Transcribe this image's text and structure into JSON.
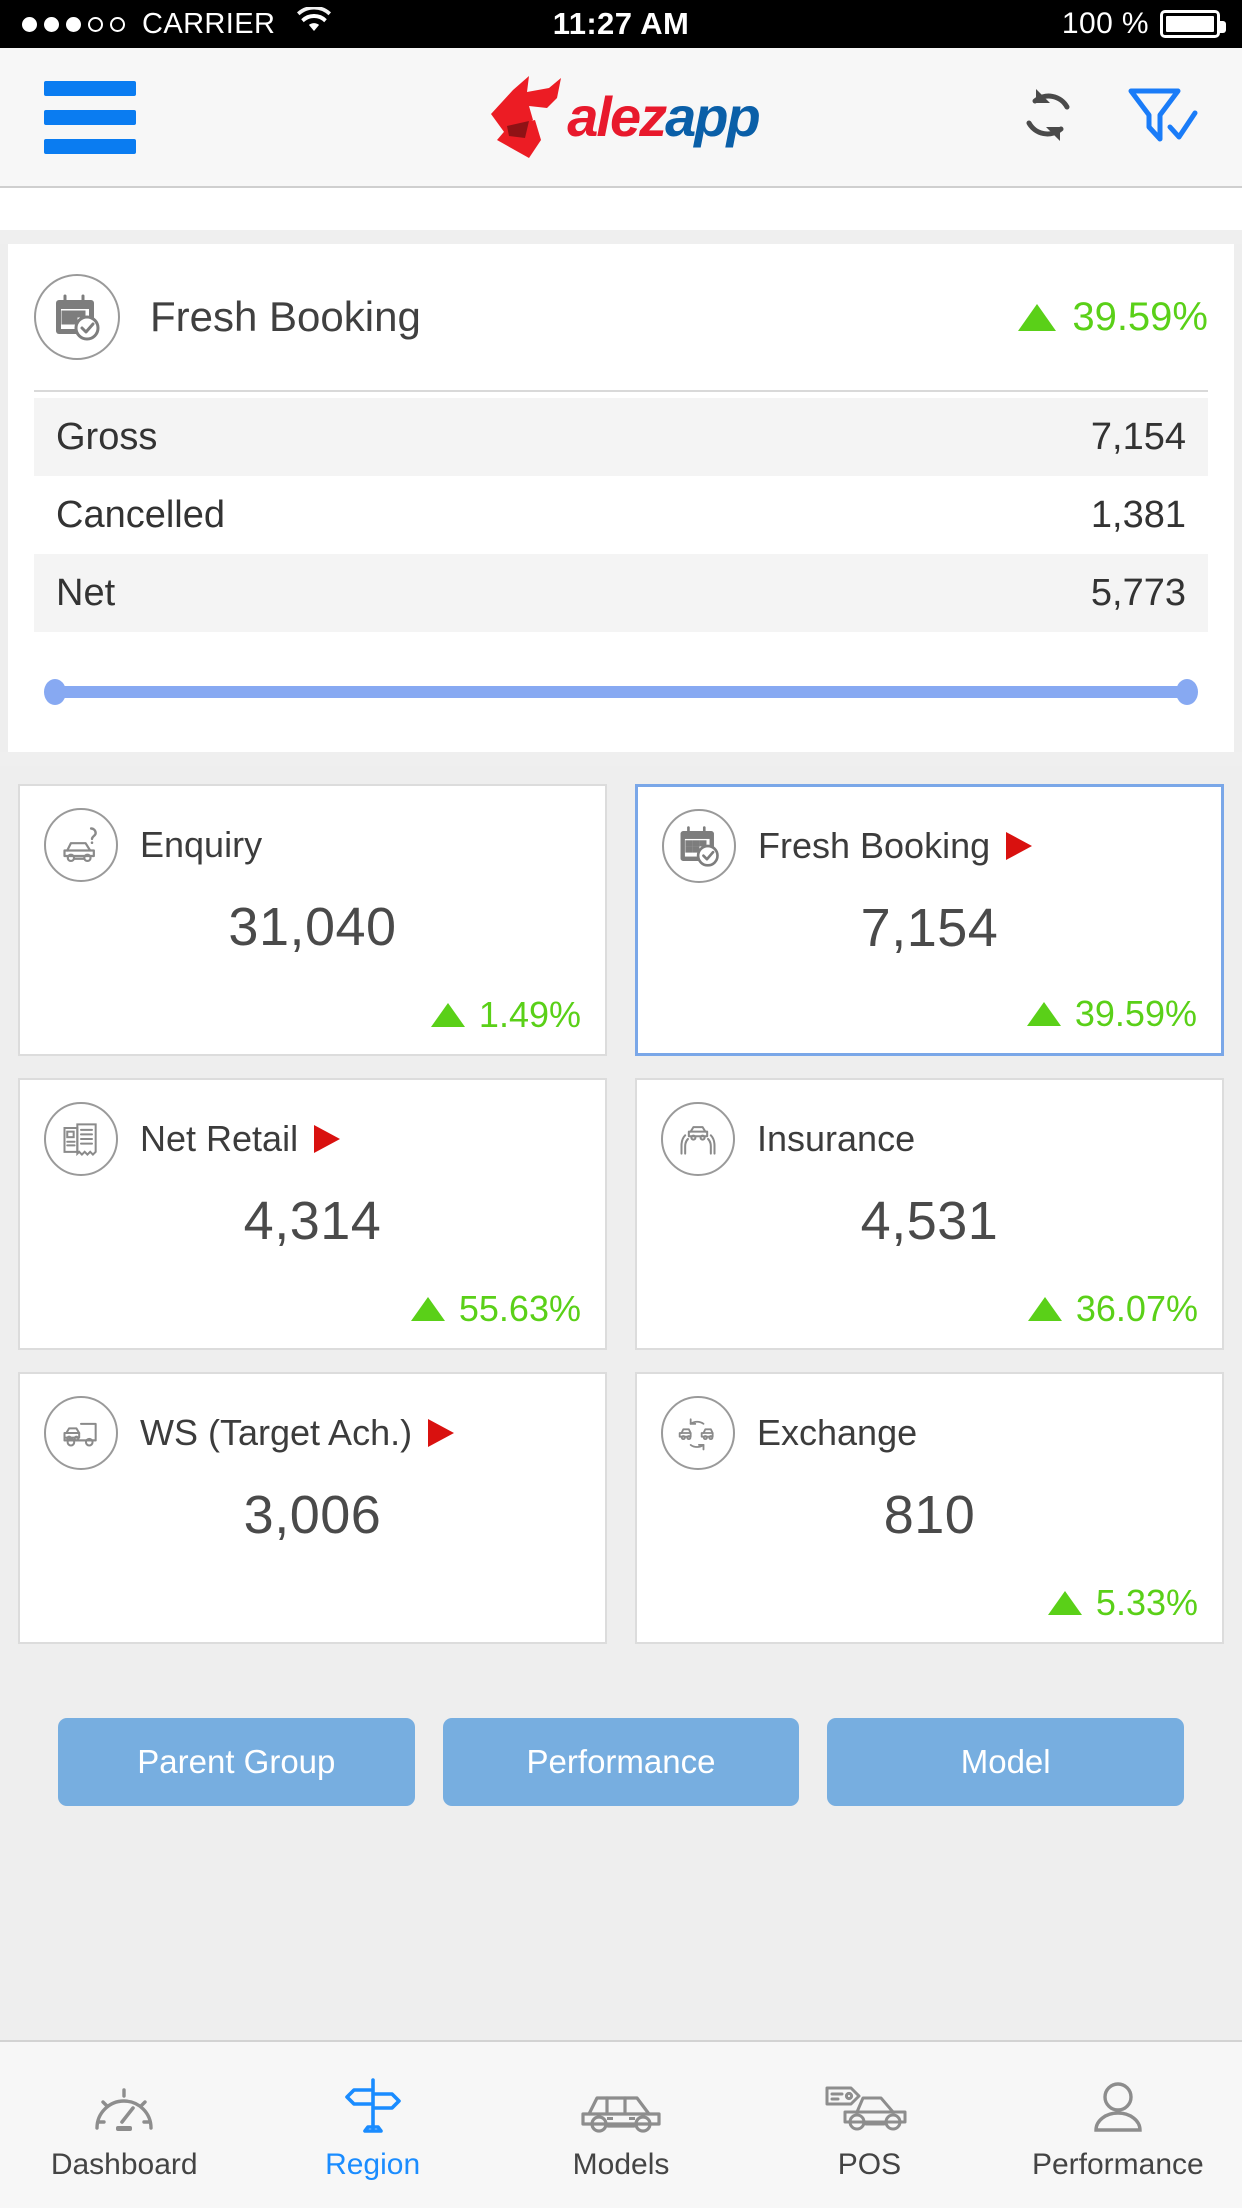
{
  "status_bar": {
    "carrier": "CARRIER",
    "signal_dots_filled": 3,
    "signal_dots_empty": 2,
    "time": "11:27 AM",
    "battery_percent": "100 %"
  },
  "header": {
    "menu_icon": "hamburger-icon",
    "logo_text_primary": "alez",
    "logo_text_secondary": "app",
    "logo_primary_color": "#e8192c",
    "logo_secondary_color": "#0a5fa8",
    "refresh_icon": "refresh-icon",
    "filter_icon": "filter-check-icon",
    "filter_color": "#1a8cff"
  },
  "summary": {
    "title": "Fresh Booking",
    "icon": "calendar-check-icon",
    "percent": "39.59%",
    "trend": "up",
    "trend_color": "#5ad018",
    "rows": [
      {
        "label": "Gross",
        "value": "7,154"
      },
      {
        "label": "Cancelled",
        "value": "1,381"
      },
      {
        "label": "Net",
        "value": "5,773"
      }
    ],
    "slider_color": "#87a9f2"
  },
  "tiles": [
    {
      "label": "Enquiry",
      "icon": "car-question-icon",
      "value": "31,040",
      "percent": "1.49%",
      "trend": "up",
      "selected": false,
      "has_arrow": false
    },
    {
      "label": "Fresh Booking",
      "icon": "calendar-check-icon",
      "value": "7,154",
      "percent": "39.59%",
      "trend": "up",
      "selected": true,
      "has_arrow": true
    },
    {
      "label": "Net Retail",
      "icon": "invoice-icon",
      "value": "4,314",
      "percent": "55.63%",
      "trend": "up",
      "selected": false,
      "has_arrow": true
    },
    {
      "label": "Insurance",
      "icon": "car-in-hands-icon",
      "value": "4,531",
      "percent": "36.07%",
      "trend": "up",
      "selected": false,
      "has_arrow": false
    },
    {
      "label": "WS (Target Ach.)",
      "icon": "car-carrier-truck-icon",
      "value": "3,006",
      "percent": "",
      "trend": "",
      "selected": false,
      "has_arrow": true
    },
    {
      "label": "Exchange",
      "icon": "car-exchange-icon",
      "value": "810",
      "percent": "5.33%",
      "trend": "up",
      "selected": false,
      "has_arrow": false
    }
  ],
  "actions": [
    {
      "label": "Parent Group"
    },
    {
      "label": "Performance"
    },
    {
      "label": "Model"
    }
  ],
  "bottom_nav": {
    "active": "Region",
    "items": [
      {
        "label": "Dashboard",
        "icon": "speedometer-icon",
        "active": false
      },
      {
        "label": "Region",
        "icon": "signpost-icon",
        "active": true
      },
      {
        "label": "Models",
        "icon": "car-icon",
        "active": false
      },
      {
        "label": "POS",
        "icon": "car-price-tag-icon",
        "active": false
      },
      {
        "label": "Performance",
        "icon": "person-icon",
        "active": false
      }
    ]
  }
}
